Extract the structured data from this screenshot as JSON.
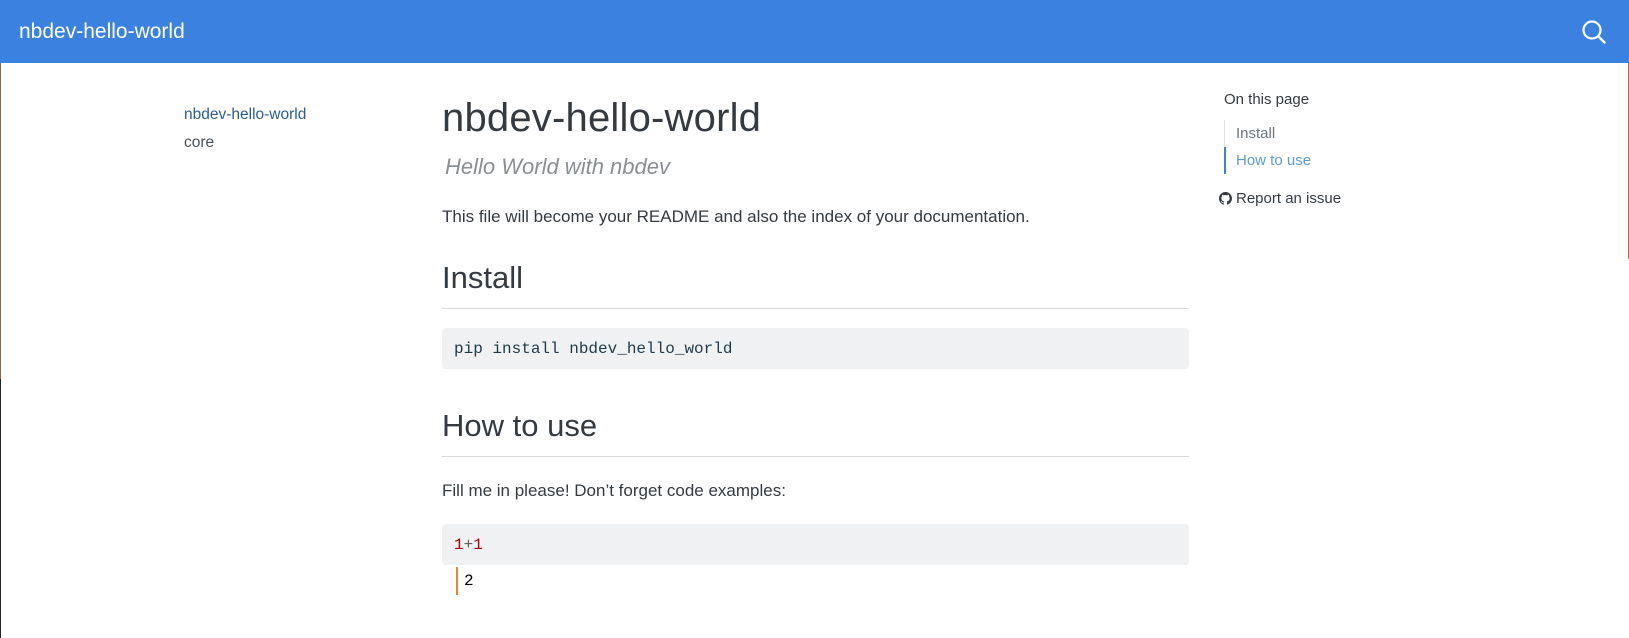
{
  "navbar": {
    "brand": "nbdev-hello-world",
    "search_icon": "search-icon"
  },
  "sidebar": {
    "items": [
      {
        "label": "nbdev-hello-world",
        "active": true
      },
      {
        "label": "core",
        "active": false
      }
    ]
  },
  "main": {
    "title": "nbdev-hello-world",
    "subtitle": "Hello World with nbdev",
    "intro": "This file will become your README and also the index of your documentation.",
    "sections": [
      {
        "heading": "Install",
        "code": "pip install nbdev_hello_world"
      },
      {
        "heading": "How to use",
        "text": "Fill me in please! Don’t forget code examples:",
        "code_parts": [
          "1",
          "+",
          "1"
        ],
        "output": "2"
      }
    ]
  },
  "toc": {
    "title": "On this page",
    "items": [
      {
        "label": "Install",
        "active": false
      },
      {
        "label": "How to use",
        "active": true
      }
    ],
    "report_label": "Report an issue",
    "report_icon": "github-icon"
  },
  "colors": {
    "navbar": "#3a81e0",
    "link_active": "#2c5d91",
    "toc_active": "#5b9bd5",
    "code_bg": "#f0f1f2",
    "output_border": "#e8882a"
  }
}
